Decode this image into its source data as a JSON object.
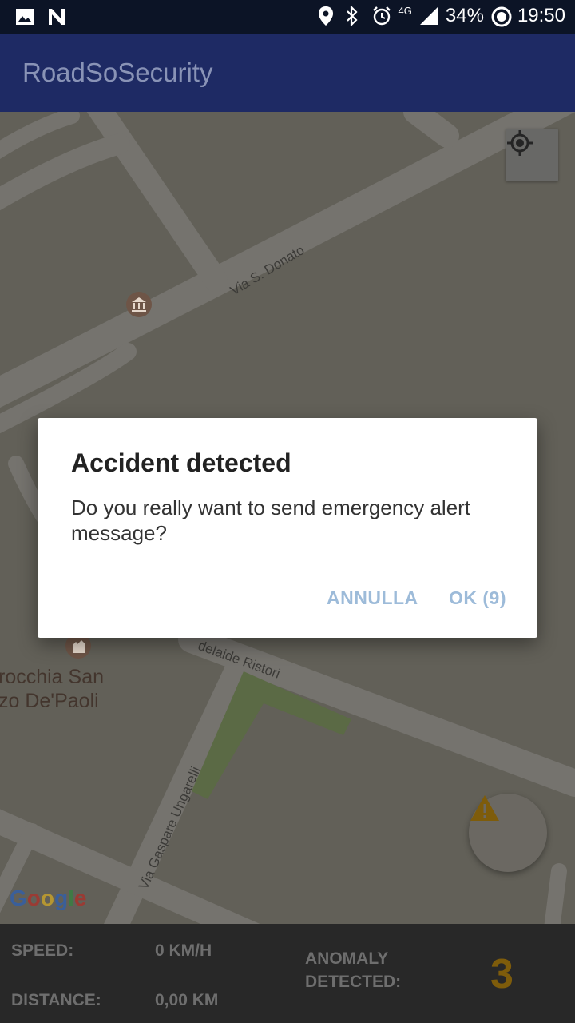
{
  "status_bar": {
    "icons_left": [
      "image-icon",
      "n-notification-icon"
    ],
    "network": "4G",
    "battery": "34%",
    "time": "19:50"
  },
  "app": {
    "title": "RoadSoSecurity"
  },
  "map": {
    "streets": [
      "Via S. Donato",
      "delaide Ristori",
      "Via Gaspare Ungarelli"
    ],
    "poi_label_line1": "rocchia San",
    "poi_label_line2": "zo De'Paoli",
    "attribution": [
      "G",
      "o",
      "o",
      "g",
      "l",
      "e"
    ]
  },
  "dialog": {
    "title": "Accident detected",
    "message": "Do you really want to send emergency alert message?",
    "cancel_label": "ANNULLA",
    "ok_label": "OK (9)"
  },
  "stats": {
    "speed_label": "SPEED:",
    "speed_value": "0 KM/H",
    "distance_label": "DISTANCE:",
    "distance_value": "0,00 KM",
    "anomaly_label_line1": "ANOMALY",
    "anomaly_label_line2": "DETECTED:",
    "anomaly_count": "3"
  },
  "colors": {
    "app_bar": "#1e2a64",
    "status_bar": "#0c1426",
    "dialog_button": "#9dbbd9",
    "anomaly_count": "#7e5c0b",
    "warning": "#7e5c0b"
  }
}
